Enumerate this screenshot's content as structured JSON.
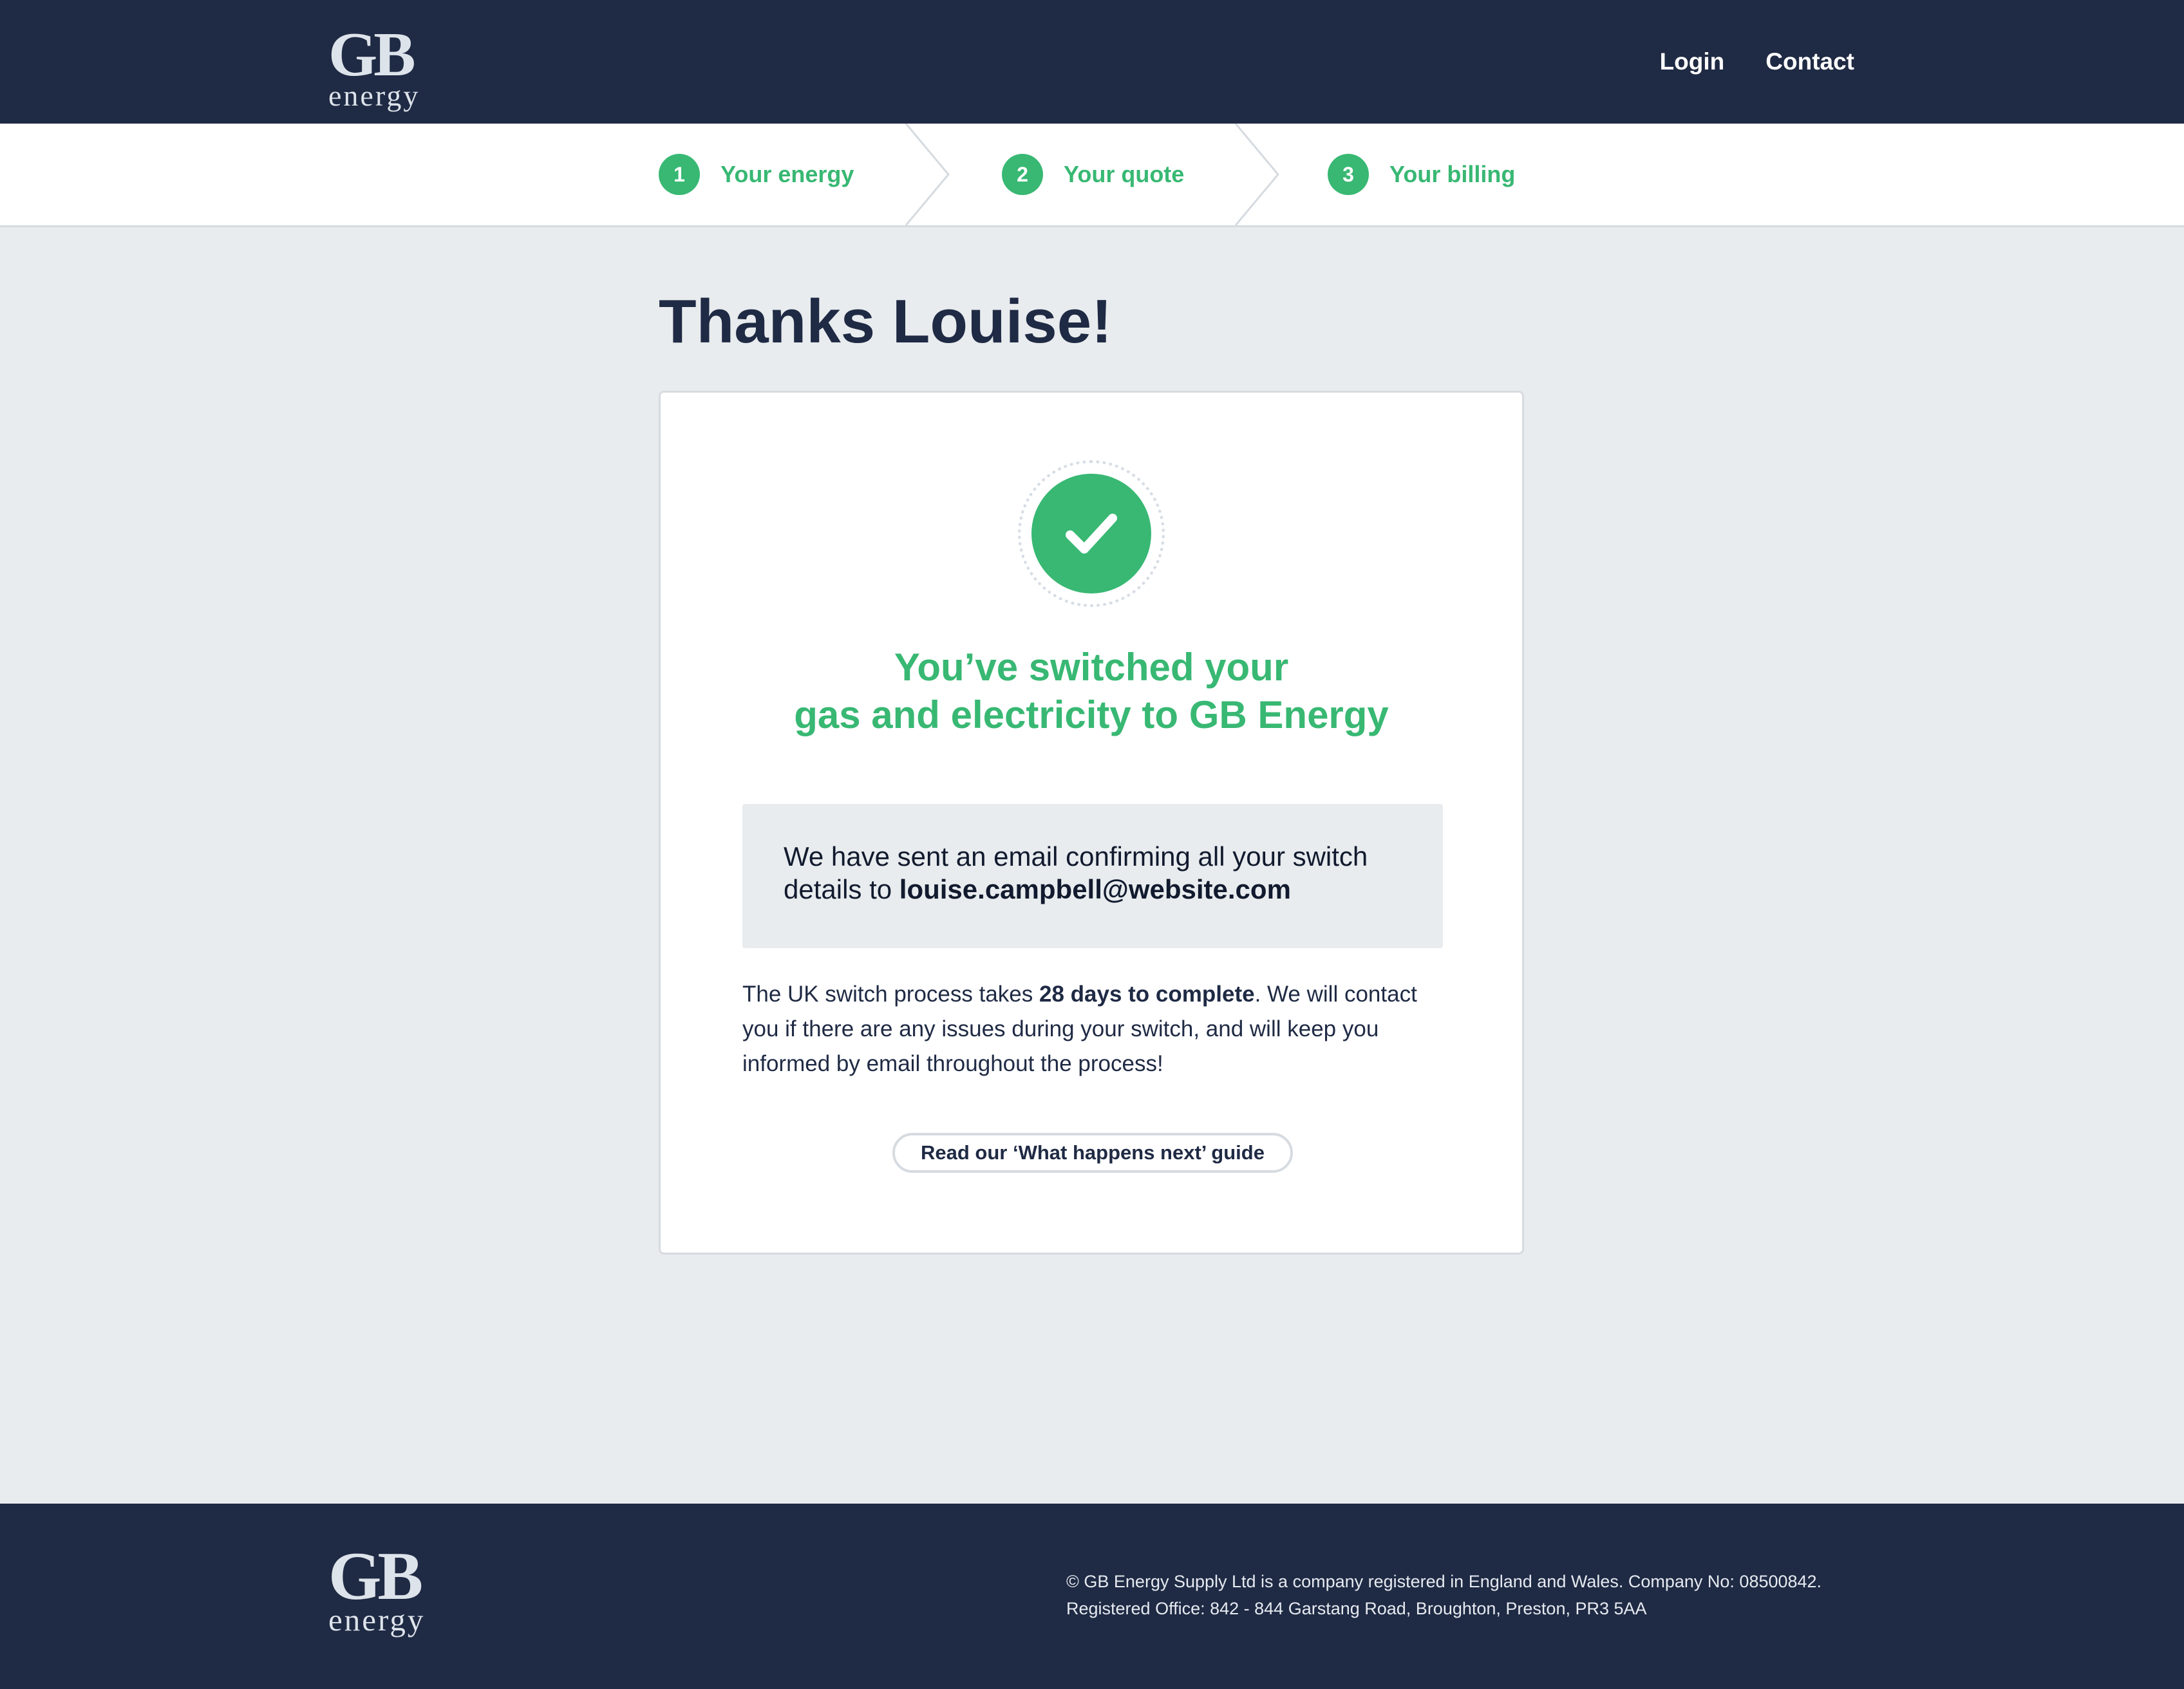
{
  "header": {
    "logo_main": "GB",
    "logo_sub": "energy",
    "nav": {
      "login": "Login",
      "contact": "Contact"
    }
  },
  "steps": [
    {
      "number": "1",
      "label": "Your energy"
    },
    {
      "number": "2",
      "label": "Your quote"
    },
    {
      "number": "3",
      "label": "Your billing"
    }
  ],
  "main": {
    "title": "Thanks Louise!",
    "success_line1": "You’ve switched your",
    "success_line2": "gas and electricity to GB Energy",
    "email_text": "We have sent an email confirming all your switch details to ",
    "email_address": "louise.campbell@website.com",
    "process_pre": "The UK switch process takes ",
    "process_bold": "28 days to complete",
    "process_post": ". We will contact you if there are any issues during your switch, and will keep you informed by email throughout the process!",
    "guide_button": "Read our ‘What happens next’ guide"
  },
  "footer": {
    "logo_main": "GB",
    "logo_sub": "energy",
    "line1": "© GB Energy Supply Ltd is a company registered in England and Wales. Company No: 08500842.",
    "line2": "Registered Office: 842 - 844 Garstang Road, Broughton, Preston, PR3 5AA"
  },
  "colors": {
    "navy": "#1f2a44",
    "green": "#38b873",
    "background": "#e8ecee"
  },
  "icons": {
    "success": "checkmark-icon",
    "step_separator": "chevron-right-icon"
  }
}
